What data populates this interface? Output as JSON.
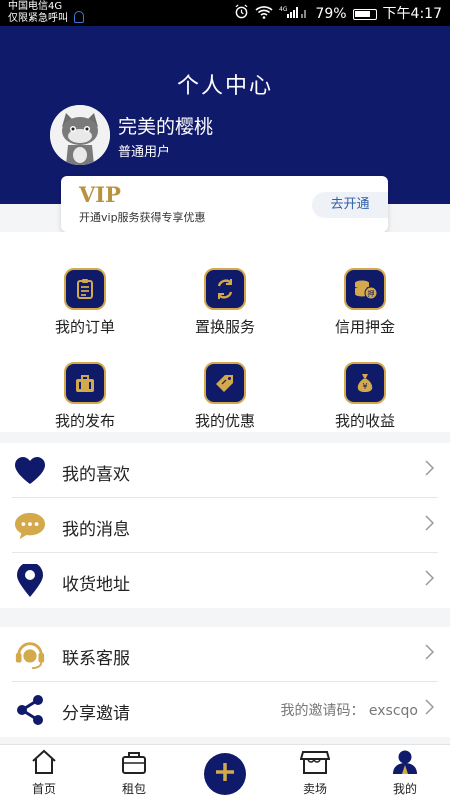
{
  "status_bar": {
    "carrier_line1": "中国电信4G",
    "carrier_line2": "仅限紧急呼叫",
    "battery": "79%",
    "time": "下午4:17"
  },
  "header": {
    "title": "个人中心",
    "user_name": "完美的樱桃",
    "user_level": "普通用户"
  },
  "vip": {
    "title": "VIP",
    "description": "开通vip服务获得专享优惠",
    "button": "去开通"
  },
  "grid": [
    {
      "label": "我的订单",
      "icon": "order-clipboard-icon"
    },
    {
      "label": "置换服务",
      "icon": "exchange-arrows-icon"
    },
    {
      "label": "信用押金",
      "icon": "deposit-coins-icon"
    },
    {
      "label": "我的发布",
      "icon": "briefcase-icon"
    },
    {
      "label": "我的优惠",
      "icon": "coupon-tag-icon"
    },
    {
      "label": "我的收益",
      "icon": "money-bag-icon"
    }
  ],
  "list_section1": [
    {
      "label": "我的喜欢",
      "icon": "heart-icon"
    },
    {
      "label": "我的消息",
      "icon": "chat-bubble-icon"
    },
    {
      "label": "收货地址",
      "icon": "location-pin-icon"
    }
  ],
  "list_section2": [
    {
      "label": "联系客服",
      "icon": "headset-icon"
    },
    {
      "label": "分享邀请",
      "icon": "share-icon",
      "value": "我的邀请码：  exscqo"
    }
  ],
  "bottom_nav": [
    {
      "label": "首页",
      "icon": "home-icon"
    },
    {
      "label": "租包",
      "icon": "bag-icon"
    },
    {
      "label": "",
      "icon": "plus-icon"
    },
    {
      "label": "卖场",
      "icon": "store-icon"
    },
    {
      "label": "我的",
      "icon": "user-icon"
    }
  ],
  "colors": {
    "primary": "#101a6b",
    "gold": "#d4a94c",
    "vip_gold": "#b8923f",
    "link_blue": "#2f5fa8"
  }
}
